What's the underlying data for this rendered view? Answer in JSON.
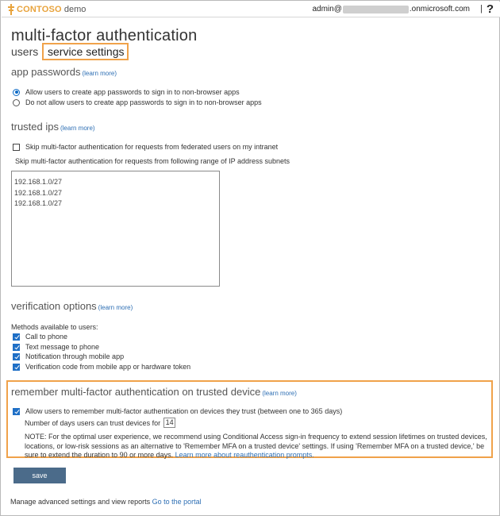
{
  "topbar": {
    "brand": "CONTOSO",
    "brand_sub": "demo",
    "account_prefix": "admin@",
    "account_suffix": ".onmicrosoft.com",
    "separator": "|",
    "help": "?"
  },
  "page": {
    "title": "multi-factor authentication",
    "tabs": [
      "users",
      "service settings"
    ]
  },
  "app_passwords": {
    "heading": "app passwords",
    "learn_more": "(learn more)",
    "options": [
      {
        "label": "Allow users to create app passwords to sign in to non-browser apps",
        "selected": true
      },
      {
        "label": "Do not allow users to create app passwords to sign in to non-browser apps",
        "selected": false
      }
    ]
  },
  "trusted_ips": {
    "heading": "trusted ips",
    "learn_more": "(learn more)",
    "skip_federated": {
      "label": "Skip multi-factor authentication for requests from federated users on my intranet",
      "checked": false
    },
    "range_label": "Skip multi-factor authentication for requests from following range of IP address subnets",
    "ranges": [
      "192.168.1.0/27",
      "192.168.1.0/27",
      "192.168.1.0/27"
    ]
  },
  "verification": {
    "heading": "verification options",
    "learn_more": "(learn more)",
    "methods_label": "Methods available to users:",
    "methods": [
      {
        "label": "Call to phone",
        "checked": true
      },
      {
        "label": "Text message to phone",
        "checked": true
      },
      {
        "label": "Notification through mobile app",
        "checked": true
      },
      {
        "label": "Verification code from mobile app or hardware token",
        "checked": true
      }
    ]
  },
  "remember": {
    "heading": "remember multi-factor authentication on trusted device",
    "learn_more": "(learn more)",
    "allow": {
      "label": "Allow users to remember multi-factor authentication on devices they trust (between one to 365 days)",
      "checked": true
    },
    "days_label": "Number of days users can trust devices for",
    "days_value": "14",
    "note": "NOTE: For the optimal user experience, we recommend using Conditional Access sign-in frequency to extend session lifetimes on trusted devices, locations, or low-risk sessions as an alternative to 'Remember MFA on a trusted device' settings. If using 'Remember MFA on a trusted device,' be sure to extend the duration to 90 or more days.",
    "note_link": "Learn more about reauthentication prompts."
  },
  "save_label": "save",
  "footer": {
    "text": "Manage advanced settings and view reports",
    "link": "Go to the portal"
  },
  "colors": {
    "brand": "#e8a33c",
    "highlight": "#f0a24a",
    "link": "#2e6fb4",
    "save_button": "#4b6b8a",
    "checkbox": "#1f6fc6"
  }
}
